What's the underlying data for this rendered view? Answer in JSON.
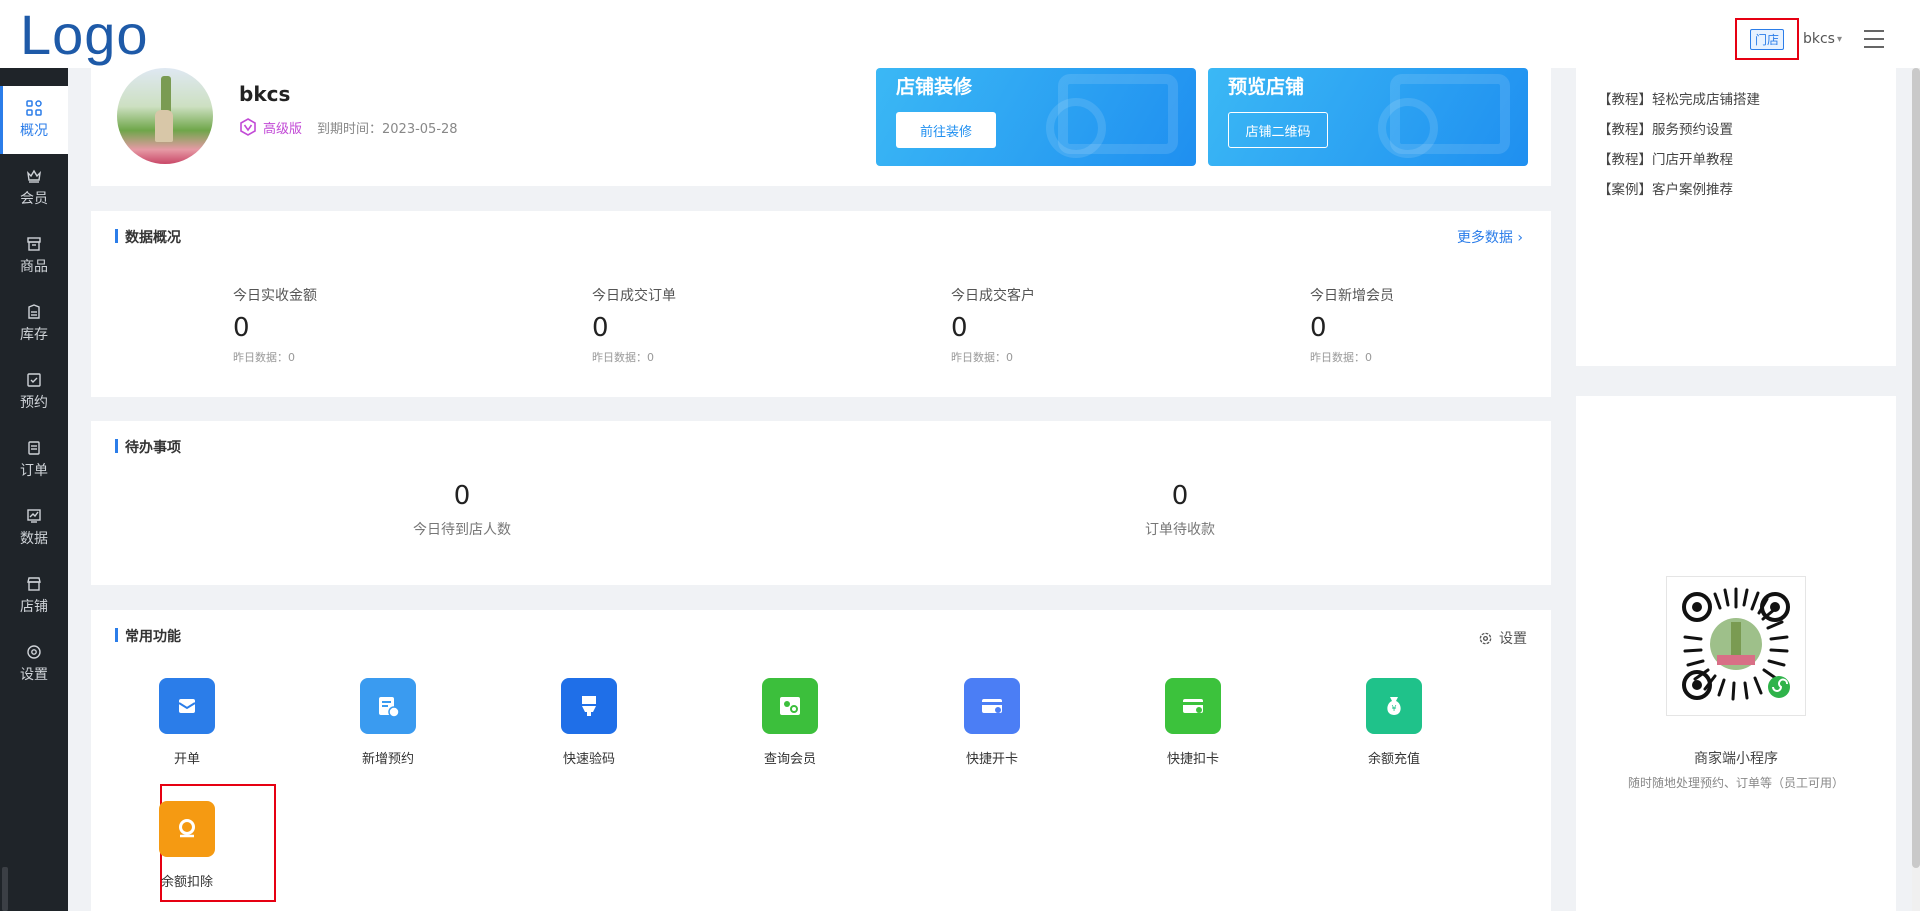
{
  "header": {
    "logo": "Logo",
    "store_tag": "门店",
    "user_name": "bkcs"
  },
  "sidebar": {
    "items": [
      {
        "label": "概况",
        "icon": "overview-icon"
      },
      {
        "label": "会员",
        "icon": "crown-icon"
      },
      {
        "label": "商品",
        "icon": "shop-box-icon"
      },
      {
        "label": "库存",
        "icon": "inventory-icon"
      },
      {
        "label": "预约",
        "icon": "calendar-check-icon"
      },
      {
        "label": "订单",
        "icon": "order-icon"
      },
      {
        "label": "数据",
        "icon": "chart-icon"
      },
      {
        "label": "店铺",
        "icon": "store-icon"
      },
      {
        "label": "设置",
        "icon": "settings-icon"
      }
    ]
  },
  "profile": {
    "name": "bkcs",
    "level": "高级版",
    "expire": "到期时间：2023-05-28"
  },
  "banners": {
    "decorate": {
      "title": "店铺装修",
      "button": "前往装修"
    },
    "preview": {
      "title": "预览店铺",
      "button": "店铺二维码"
    }
  },
  "overview": {
    "title": "数据概况",
    "more": "更多数据",
    "stats": [
      {
        "label": "今日实收金额",
        "value": "0",
        "sub": "昨日数据：0"
      },
      {
        "label": "今日成交订单",
        "value": "0",
        "sub": "昨日数据：0"
      },
      {
        "label": "今日成交客户",
        "value": "0",
        "sub": "昨日数据：0"
      },
      {
        "label": "今日新增会员",
        "value": "0",
        "sub": "昨日数据：0"
      }
    ]
  },
  "todo": {
    "title": "待办事项",
    "items": [
      {
        "value": "0",
        "label": "今日待到店人数"
      },
      {
        "value": "0",
        "label": "订单待收款"
      }
    ]
  },
  "functions": {
    "title": "常用功能",
    "settings": "设置",
    "items": [
      {
        "label": "开单",
        "icon": "open-order-icon",
        "color": "#2b7de9"
      },
      {
        "label": "新增预约",
        "icon": "new-appointment-icon",
        "color": "#3a9bf0"
      },
      {
        "label": "快速验码",
        "icon": "verify-code-icon",
        "color": "#1f6fe8"
      },
      {
        "label": "查询会员",
        "icon": "search-member-icon",
        "color": "#3cbf3c"
      },
      {
        "label": "快捷开卡",
        "icon": "open-card-icon",
        "color": "#4b7ef5"
      },
      {
        "label": "快捷扣卡",
        "icon": "deduct-card-icon",
        "color": "#3cc23c"
      },
      {
        "label": "余额充值",
        "icon": "balance-recharge-icon",
        "color": "#1fc28a"
      },
      {
        "label": "余额扣除",
        "icon": "balance-deduct-icon",
        "color": "#f59a12"
      }
    ]
  },
  "tutorials": [
    "【教程】轻松完成店铺搭建",
    "【教程】服务预约设置",
    "【教程】门店开单教程",
    "【案例】客户案例推荐"
  ],
  "miniprogram": {
    "title": "商家端小程序",
    "subtitle": "随时随地处理预约、订单等（员工可用）"
  }
}
